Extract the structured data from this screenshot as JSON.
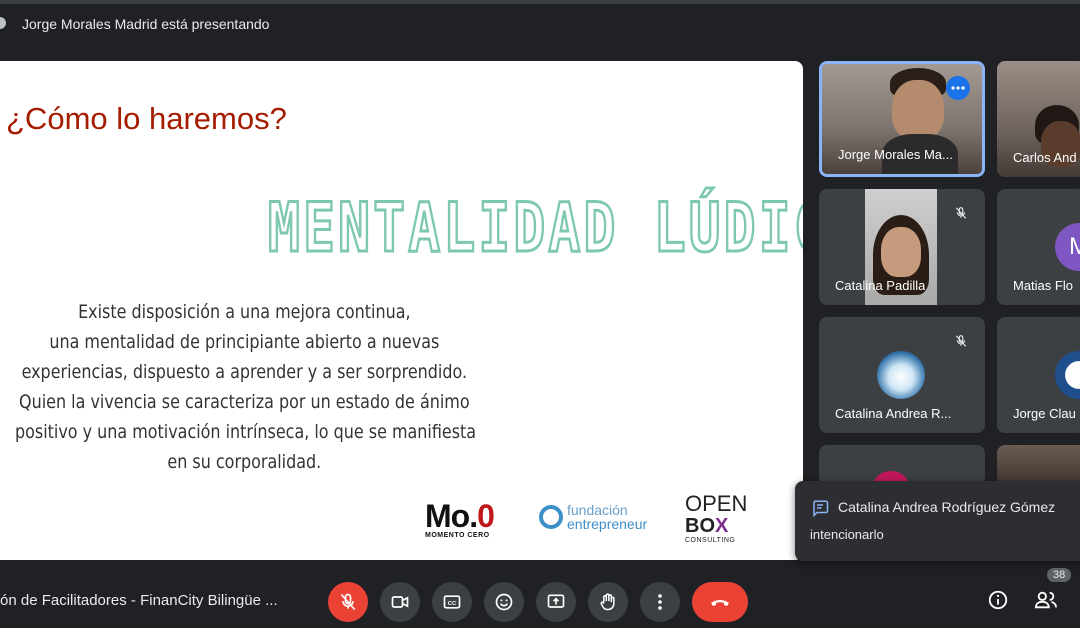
{
  "header": {
    "presenting_text": "Jorge Morales Madrid está presentando"
  },
  "slide": {
    "heading": "¿Cómo lo haremos?",
    "title": "MENTALIDAD LÚDICA",
    "body_lines": [
      "Existe disposición a una mejora continua,",
      "una mentalidad de principiante abierto a nuevas",
      "experiencias, dispuesto a aprender y a ser sorprendido.",
      "Quien la vivencia se caracteriza por un estado de ánimo",
      "positivo y una motivación intrínseca, lo que se manifiesta",
      "en su corporalidad."
    ],
    "logos": {
      "momento_big": "Mo.",
      "momento_big_accent": "0",
      "momento_small": "MOMENTO CERO",
      "fundacion_line1": "fundación",
      "fundacion_line2": "entrepreneur",
      "openbox_line1": "OPEN",
      "openbox_line2a": "BO",
      "openbox_line2b": "X",
      "openbox_line3": "CONSULTING"
    }
  },
  "participants": [
    {
      "name": "Jorge Morales Ma...",
      "type": "video",
      "active": true
    },
    {
      "name": "Carlos And",
      "type": "video"
    },
    {
      "name": "Catalina Padilla",
      "type": "video",
      "muted": true
    },
    {
      "name": "Matias Flo",
      "type": "avatar",
      "initial": "M"
    },
    {
      "name": "Catalina Andrea R...",
      "type": "avatar-img",
      "muted": true
    },
    {
      "name": "Jorge Clau",
      "type": "avatar-img"
    }
  ],
  "notification": {
    "sender": "Catalina Andrea Rodríguez Gómez",
    "message": "intencionarlo"
  },
  "bottom": {
    "meeting_name": "ón de Facilitadores - FinanCity Bilingüe ...",
    "participant_count": "38"
  },
  "colors": {
    "background": "#202124",
    "active_border": "#8ab4f8",
    "danger": "#ea4335",
    "heading_red": "#a61c00",
    "title_green": "#7ec8b2"
  }
}
